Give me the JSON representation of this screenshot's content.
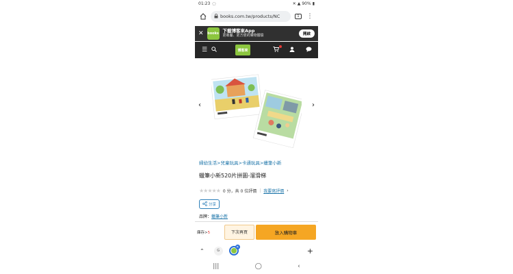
{
  "status": {
    "time": "01:23",
    "battery": "90%"
  },
  "browser": {
    "url": "books.com.tw/products/NC",
    "tab_count": "1"
  },
  "app_banner": {
    "logo_text": "books",
    "title": "下載博客來App",
    "subtitle": "更專屬、更方便的購物體驗",
    "open_label": "開啟"
  },
  "navbar": {
    "brand_text": "博客來"
  },
  "product": {
    "breadcrumb": "婦幼生活>兒童玩具>卡通玩具>蠟筆小新",
    "title": "蠟筆小新520片拼圖-溜滑梯",
    "rating_text": "0 分，共 0 位評價",
    "review_link": "我要寫評價",
    "share_label": "分享",
    "brand_label": "品牌：",
    "brand_name": "蠟筆小新",
    "stars": "★★★★★"
  },
  "buybar": {
    "stock_label": "庫存>",
    "stock_value": "5",
    "later_label": "下次再買",
    "cart_label": "放入購物車"
  },
  "tabs": {
    "tab1_letter": "G"
  }
}
